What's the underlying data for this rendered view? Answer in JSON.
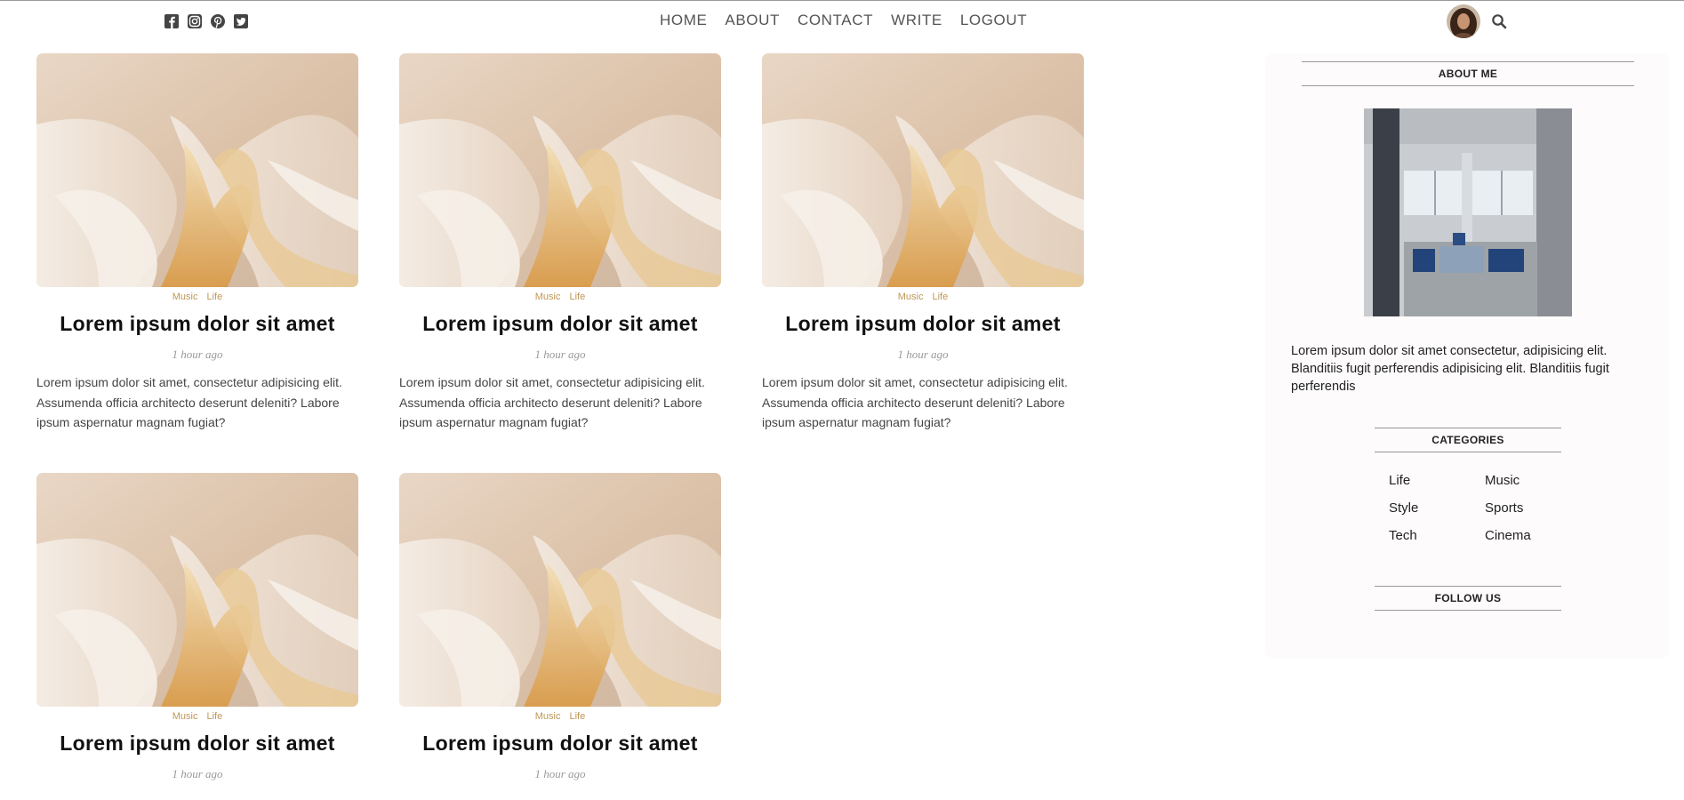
{
  "header": {
    "social_icons": [
      "facebook-square-icon",
      "instagram-icon",
      "pinterest-square-icon",
      "twitter-square-icon"
    ],
    "nav": [
      "HOME",
      "ABOUT",
      "CONTACT",
      "WRITE",
      "LOGOUT"
    ],
    "avatar": "user-avatar",
    "search_icon": "search-icon"
  },
  "posts": [
    {
      "categories": [
        "Music",
        "Life"
      ],
      "title": "Lorem ipsum dolor sit amet",
      "date": "1 hour ago",
      "description": "Lorem ipsum dolor sit amet, consectetur adipisicing elit. Assumenda officia architecto deserunt deleniti? Labore ipsum aspernatur magnam fugiat?"
    },
    {
      "categories": [
        "Music",
        "Life"
      ],
      "title": "Lorem ipsum dolor sit amet",
      "date": "1 hour ago",
      "description": "Lorem ipsum dolor sit amet, consectetur adipisicing elit. Assumenda officia architecto deserunt deleniti? Labore ipsum aspernatur magnam fugiat?"
    },
    {
      "categories": [
        "Music",
        "Life"
      ],
      "title": "Lorem ipsum dolor sit amet",
      "date": "1 hour ago",
      "description": "Lorem ipsum dolor sit amet, consectetur adipisicing elit. Assumenda officia architecto deserunt deleniti? Labore ipsum aspernatur magnam fugiat?"
    },
    {
      "categories": [
        "Music",
        "Life"
      ],
      "title": "Lorem ipsum dolor sit amet",
      "date": "1 hour ago",
      "description": ""
    },
    {
      "categories": [
        "Music",
        "Life"
      ],
      "title": "Lorem ipsum dolor sit amet",
      "date": "1 hour ago",
      "description": ""
    }
  ],
  "sidebar": {
    "about_title": "ABOUT ME",
    "about_text": "Lorem ipsum dolor sit amet consectetur, adipisicing elit. Blanditiis fugit perferendis adipisicing elit. Blanditiis fugit perferendis",
    "categories_title": "CATEGORIES",
    "categories": [
      "Life",
      "Music",
      "Style",
      "Sports",
      "Tech",
      "Cinema"
    ],
    "follow_title": "FOLLOW US"
  },
  "colors": {
    "category_accent": "#be9656",
    "sidebar_bg": "#fdfbfb"
  }
}
